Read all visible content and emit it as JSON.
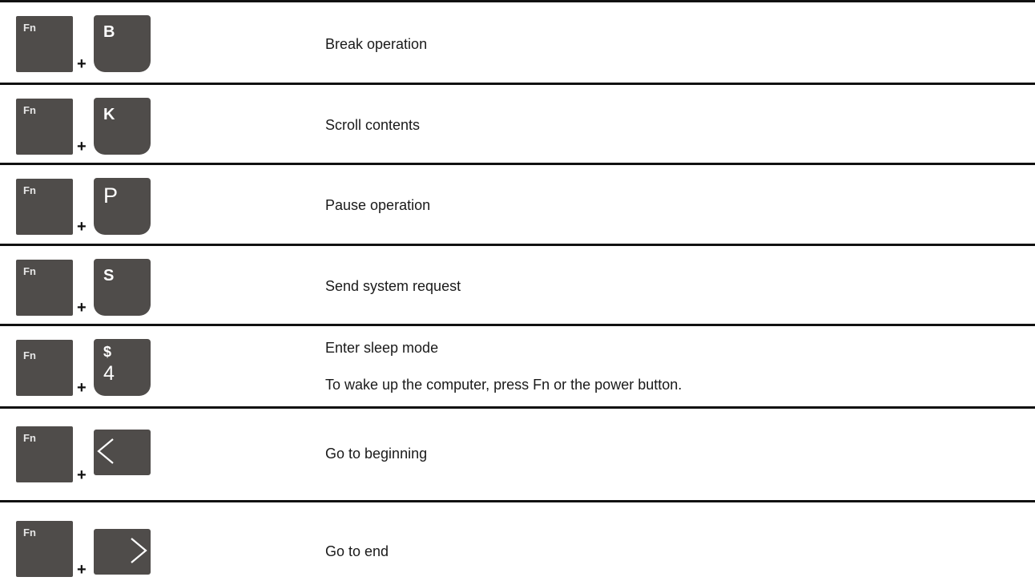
{
  "rows": [
    {
      "fn": "Fn",
      "plus": "+",
      "key": "B",
      "desc": "Break operation"
    },
    {
      "fn": "Fn",
      "plus": "+",
      "key": "K",
      "desc": "Scroll contents"
    },
    {
      "fn": "Fn",
      "plus": "+",
      "key": "P",
      "desc": "Pause operation"
    },
    {
      "fn": "Fn",
      "plus": "+",
      "key": "S",
      "desc": "Send system request"
    },
    {
      "fn": "Fn",
      "plus": "+",
      "key_top": "$",
      "key_bottom": "4",
      "desc": "Enter sleep mode",
      "desc2": "To wake up the computer, press Fn or the power button."
    },
    {
      "fn": "Fn",
      "plus": "+",
      "key_icon": "left-arrow-icon",
      "desc": "Go to beginning"
    },
    {
      "fn": "Fn",
      "plus": "+",
      "key_icon": "right-arrow-icon",
      "desc": "Go to end"
    }
  ],
  "colors": {
    "key_fill": "#4f4c4a",
    "rule": "#111111"
  }
}
